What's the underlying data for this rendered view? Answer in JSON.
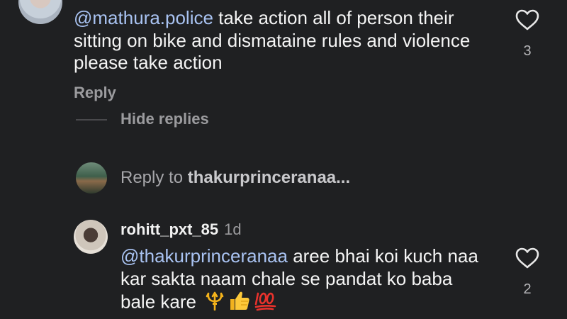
{
  "comment_top": {
    "mention": "@mathura.police",
    "text": " take action all of person their sitting on bike and dismataine rules and violence please take action",
    "reply_label": "Reply",
    "like_count": "3"
  },
  "thread": {
    "hide_replies_label": "Hide replies",
    "reply_to_prefix": "Reply to ",
    "reply_to_user": "thakurprinceranaa..."
  },
  "comment_reply": {
    "username": "rohitt_pxt_85",
    "time": "1d",
    "mention": "@thakurprinceranaa",
    "text": " aree bhai koi kuch naa kar sakta naam chale se pandat ko baba bale kare",
    "like_count": "2",
    "emojis": [
      "trident",
      "thumbs-up",
      "hundred-points"
    ]
  },
  "colors": {
    "background": "#1f2022",
    "mention": "#a9c3f2",
    "secondary_text": "#9b9b9e"
  }
}
